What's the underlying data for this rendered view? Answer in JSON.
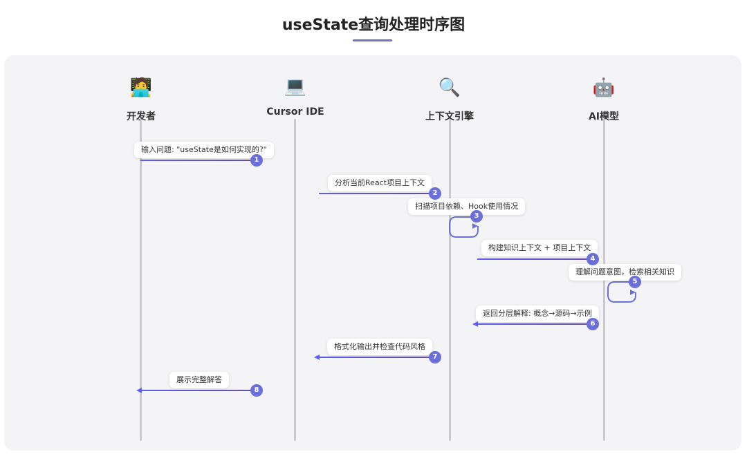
{
  "title": "useState查询处理时序图",
  "actors": [
    {
      "label": "开发者",
      "icon": "🧑‍💻",
      "icon_name": "developer-icon"
    },
    {
      "label": "Cursor IDE",
      "icon": "💻",
      "icon_name": "laptop-icon"
    },
    {
      "label": "上下文引擎",
      "icon": "🔍",
      "icon_name": "magnifier-icon"
    },
    {
      "label": "AI模型",
      "icon": "🤖",
      "icon_name": "robot-icon"
    }
  ],
  "messages": [
    {
      "step": "1",
      "label": "输入问题: \"useState是如何实现的?\""
    },
    {
      "step": "2",
      "label": "分析当前React项目上下文"
    },
    {
      "step": "3",
      "label": "扫描项目依赖、Hook使用情况"
    },
    {
      "step": "4",
      "label": "构建知识上下文 + 项目上下文"
    },
    {
      "step": "5",
      "label": "理解问题意图，检索相关知识"
    },
    {
      "step": "6",
      "label": "返回分层解释: 概念→源码→示例"
    },
    {
      "step": "7",
      "label": "格式化输出并检查代码风格"
    },
    {
      "step": "8",
      "label": "展示完整解答"
    }
  ],
  "colors": {
    "accent": "#6a6fd9",
    "arrow_start": "#5c5ff0",
    "arrow_end": "#6a4fa8",
    "lifeline": "#c9c9cf",
    "panel": "#f4f4f6"
  }
}
